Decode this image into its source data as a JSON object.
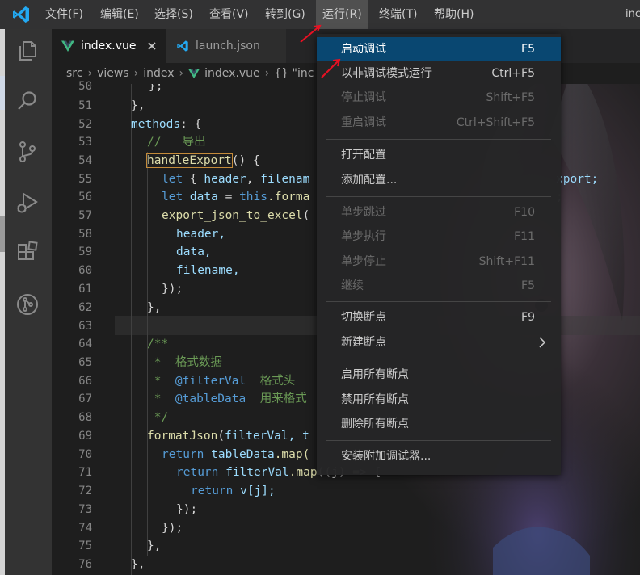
{
  "titlebar": {
    "menus": [
      "文件(F)",
      "编辑(E)",
      "选择(S)",
      "查看(V)",
      "转到(G)",
      "运行(R)",
      "终端(T)",
      "帮助(H)"
    ],
    "active_menu": "运行(R)",
    "right_text": "inc"
  },
  "tabs": [
    {
      "label": "index.vue",
      "icon": "vue-icon",
      "active": true
    },
    {
      "label": "launch.json",
      "icon": "vscode-json-icon",
      "active": false
    }
  ],
  "breadcrumb": [
    "src",
    "views",
    "index",
    "index.vue",
    "{} \"inc"
  ],
  "editor": {
    "line_numbers": [
      50,
      51,
      52,
      53,
      54,
      55,
      56,
      57,
      58,
      59,
      60,
      61,
      62,
      63,
      64,
      65,
      66,
      67,
      68,
      69,
      70,
      71,
      72,
      73,
      74,
      75,
      76
    ],
    "code": {
      "l50": "};",
      "l51": "},",
      "l52_a": "methods",
      "l52_b": ": {",
      "l53": "//   导出",
      "l54_fn": "handleExport",
      "l54_b": "() {",
      "l55_let": "let",
      "l55_b": " { ",
      "l55_c": "header",
      "l55_d": ", ",
      "l55_e": "filenam",
      "l55_tail": "xport;",
      "l56_let": "let",
      "l56_v": " data",
      "l56_eq": " = ",
      "l56_this": "this",
      "l56_f": ".forma",
      "l56_tail": ";",
      "l57_f": "export_json_to_excel",
      "l57_p": "(",
      "l58": "header,",
      "l59": "data,",
      "l60": "filename,",
      "l61": "});",
      "l62": "},",
      "l64": "/**",
      "l65": " *  格式数据",
      "l66_a": " *  ",
      "l66_b": "@filterVal",
      "l66_c": "  格式头",
      "l67_a": " *  ",
      "l67_b": "@tableData",
      "l67_c": "  用来格式",
      "l68": " */",
      "l69_f": "formatJson",
      "l69_p": "(",
      "l69_v": "filterVal",
      "l69_tail": ", t",
      "l70_r": "return",
      "l70_v": " tableData",
      "l70_f": ".map(",
      "l71_r": "return",
      "l71_v": " filterVal",
      "l71_f": ".map",
      "l71_tail": "((j) => {",
      "l72_r": "return",
      "l72_v": " v[j];",
      "l73": "});",
      "l74": "});",
      "l75": "},",
      "l76": "},"
    }
  },
  "run_menu": {
    "groups": [
      [
        {
          "label": "启动调试",
          "shortcut": "F5",
          "state": "selected"
        },
        {
          "label": "以非调试模式运行",
          "shortcut": "Ctrl+F5",
          "state": "enabled"
        },
        {
          "label": "停止调试",
          "shortcut": "Shift+F5",
          "state": "disabled"
        },
        {
          "label": "重启调试",
          "shortcut": "Ctrl+Shift+F5",
          "state": "disabled"
        }
      ],
      [
        {
          "label": "打开配置",
          "shortcut": "",
          "state": "enabled"
        },
        {
          "label": "添加配置...",
          "shortcut": "",
          "state": "enabled"
        }
      ],
      [
        {
          "label": "单步跳过",
          "shortcut": "F10",
          "state": "disabled"
        },
        {
          "label": "单步执行",
          "shortcut": "F11",
          "state": "disabled"
        },
        {
          "label": "单步停止",
          "shortcut": "Shift+F11",
          "state": "disabled"
        },
        {
          "label": "继续",
          "shortcut": "F5",
          "state": "disabled"
        }
      ],
      [
        {
          "label": "切换断点",
          "shortcut": "F9",
          "state": "enabled"
        },
        {
          "label": "新建断点",
          "shortcut": "",
          "state": "enabled",
          "submenu": true
        }
      ],
      [
        {
          "label": "启用所有断点",
          "shortcut": "",
          "state": "enabled"
        },
        {
          "label": "禁用所有断点",
          "shortcut": "",
          "state": "enabled"
        },
        {
          "label": "删除所有断点",
          "shortcut": "",
          "state": "enabled"
        }
      ],
      [
        {
          "label": "安装附加调试器...",
          "shortcut": "",
          "state": "enabled"
        }
      ]
    ]
  },
  "colors": {
    "accent_selected": "#094771",
    "annotation_arrow": "#e81123",
    "vue_green": "#41b883",
    "vscode_blue": "#23a9f2"
  }
}
